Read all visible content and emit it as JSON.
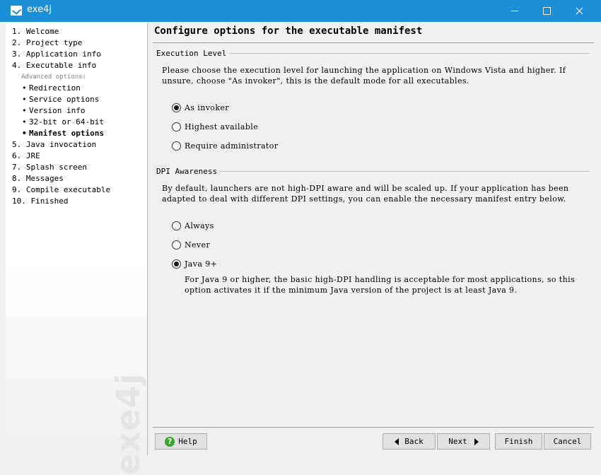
{
  "window": {
    "title": "exe4j"
  },
  "nav": {
    "steps": [
      "1. Welcome",
      "2. Project type",
      "3. Application info",
      "4. Executable info"
    ],
    "advanced_label": "Advanced options:",
    "sub_items": [
      "Redirection",
      "Service options",
      "Version info",
      "32-bit or 64-bit",
      "Manifest options"
    ],
    "bullet": "•",
    "steps_after": [
      "5. Java invocation",
      "6. JRE",
      "7. Splash screen",
      "8. Messages",
      "9. Compile executable",
      "10. Finished"
    ],
    "watermark": "exe4j"
  },
  "page": {
    "title": "Configure options for the executable manifest",
    "execution_level": {
      "group_title": "Execution Level",
      "desc_line1": "Please choose the execution level for launching the application on Windows Vista and higher. If",
      "desc_line2": "unsure, choose \"As invoker\", this is the default mode for all executables.",
      "options": [
        "As invoker",
        "Highest available",
        "Require administrator"
      ],
      "selected": "As invoker"
    },
    "dpi_awareness": {
      "group_title": "DPI Awareness",
      "desc_line1": "By default, launchers are not high-DPI aware and will be scaled up. If your application has been",
      "desc_line2": "adapted to deal with different DPI settings, you can enable the necessary manifest entry below.",
      "options": [
        "Always",
        "Never",
        "Java 9+"
      ],
      "selected": "Java 9+",
      "note_line1": "For Java 9 or higher, the basic high-DPI handling is acceptable for most applications, so this",
      "note_line2": "option activates it if the minimum Java version of the project is at least Java 9."
    }
  },
  "buttons": {
    "help": "Help",
    "help_icon_glyph": "?",
    "back": "Back",
    "next": "Next",
    "finish": "Finish",
    "cancel": "Cancel"
  }
}
